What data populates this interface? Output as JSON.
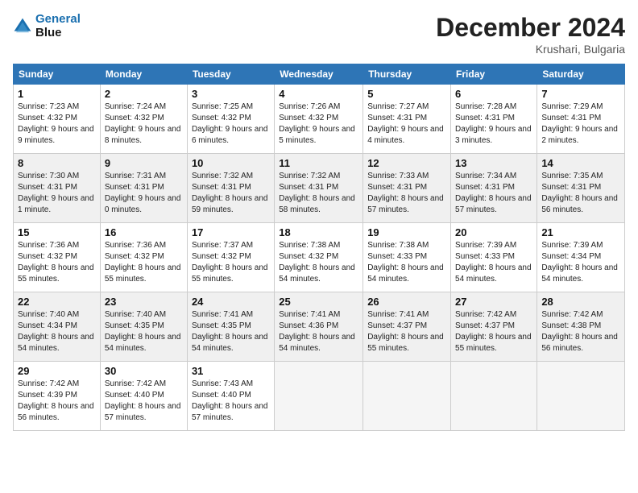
{
  "header": {
    "logo_line1": "General",
    "logo_line2": "Blue",
    "month_title": "December 2024",
    "location": "Krushari, Bulgaria"
  },
  "weekdays": [
    "Sunday",
    "Monday",
    "Tuesday",
    "Wednesday",
    "Thursday",
    "Friday",
    "Saturday"
  ],
  "weeks": [
    [
      {
        "day": "1",
        "sunrise": "7:23 AM",
        "sunset": "4:32 PM",
        "daylight": "9 hours and 9 minutes."
      },
      {
        "day": "2",
        "sunrise": "7:24 AM",
        "sunset": "4:32 PM",
        "daylight": "9 hours and 8 minutes."
      },
      {
        "day": "3",
        "sunrise": "7:25 AM",
        "sunset": "4:32 PM",
        "daylight": "9 hours and 6 minutes."
      },
      {
        "day": "4",
        "sunrise": "7:26 AM",
        "sunset": "4:32 PM",
        "daylight": "9 hours and 5 minutes."
      },
      {
        "day": "5",
        "sunrise": "7:27 AM",
        "sunset": "4:31 PM",
        "daylight": "9 hours and 4 minutes."
      },
      {
        "day": "6",
        "sunrise": "7:28 AM",
        "sunset": "4:31 PM",
        "daylight": "9 hours and 3 minutes."
      },
      {
        "day": "7",
        "sunrise": "7:29 AM",
        "sunset": "4:31 PM",
        "daylight": "9 hours and 2 minutes."
      }
    ],
    [
      {
        "day": "8",
        "sunrise": "7:30 AM",
        "sunset": "4:31 PM",
        "daylight": "9 hours and 1 minute."
      },
      {
        "day": "9",
        "sunrise": "7:31 AM",
        "sunset": "4:31 PM",
        "daylight": "9 hours and 0 minutes."
      },
      {
        "day": "10",
        "sunrise": "7:32 AM",
        "sunset": "4:31 PM",
        "daylight": "8 hours and 59 minutes."
      },
      {
        "day": "11",
        "sunrise": "7:32 AM",
        "sunset": "4:31 PM",
        "daylight": "8 hours and 58 minutes."
      },
      {
        "day": "12",
        "sunrise": "7:33 AM",
        "sunset": "4:31 PM",
        "daylight": "8 hours and 57 minutes."
      },
      {
        "day": "13",
        "sunrise": "7:34 AM",
        "sunset": "4:31 PM",
        "daylight": "8 hours and 57 minutes."
      },
      {
        "day": "14",
        "sunrise": "7:35 AM",
        "sunset": "4:31 PM",
        "daylight": "8 hours and 56 minutes."
      }
    ],
    [
      {
        "day": "15",
        "sunrise": "7:36 AM",
        "sunset": "4:32 PM",
        "daylight": "8 hours and 55 minutes."
      },
      {
        "day": "16",
        "sunrise": "7:36 AM",
        "sunset": "4:32 PM",
        "daylight": "8 hours and 55 minutes."
      },
      {
        "day": "17",
        "sunrise": "7:37 AM",
        "sunset": "4:32 PM",
        "daylight": "8 hours and 55 minutes."
      },
      {
        "day": "18",
        "sunrise": "7:38 AM",
        "sunset": "4:32 PM",
        "daylight": "8 hours and 54 minutes."
      },
      {
        "day": "19",
        "sunrise": "7:38 AM",
        "sunset": "4:33 PM",
        "daylight": "8 hours and 54 minutes."
      },
      {
        "day": "20",
        "sunrise": "7:39 AM",
        "sunset": "4:33 PM",
        "daylight": "8 hours and 54 minutes."
      },
      {
        "day": "21",
        "sunrise": "7:39 AM",
        "sunset": "4:34 PM",
        "daylight": "8 hours and 54 minutes."
      }
    ],
    [
      {
        "day": "22",
        "sunrise": "7:40 AM",
        "sunset": "4:34 PM",
        "daylight": "8 hours and 54 minutes."
      },
      {
        "day": "23",
        "sunrise": "7:40 AM",
        "sunset": "4:35 PM",
        "daylight": "8 hours and 54 minutes."
      },
      {
        "day": "24",
        "sunrise": "7:41 AM",
        "sunset": "4:35 PM",
        "daylight": "8 hours and 54 minutes."
      },
      {
        "day": "25",
        "sunrise": "7:41 AM",
        "sunset": "4:36 PM",
        "daylight": "8 hours and 54 minutes."
      },
      {
        "day": "26",
        "sunrise": "7:41 AM",
        "sunset": "4:37 PM",
        "daylight": "8 hours and 55 minutes."
      },
      {
        "day": "27",
        "sunrise": "7:42 AM",
        "sunset": "4:37 PM",
        "daylight": "8 hours and 55 minutes."
      },
      {
        "day": "28",
        "sunrise": "7:42 AM",
        "sunset": "4:38 PM",
        "daylight": "8 hours and 56 minutes."
      }
    ],
    [
      {
        "day": "29",
        "sunrise": "7:42 AM",
        "sunset": "4:39 PM",
        "daylight": "8 hours and 56 minutes."
      },
      {
        "day": "30",
        "sunrise": "7:42 AM",
        "sunset": "4:40 PM",
        "daylight": "8 hours and 57 minutes."
      },
      {
        "day": "31",
        "sunrise": "7:43 AM",
        "sunset": "4:40 PM",
        "daylight": "8 hours and 57 minutes."
      },
      null,
      null,
      null,
      null
    ]
  ],
  "labels": {
    "sunrise": "Sunrise:",
    "sunset": "Sunset:",
    "daylight": "Daylight:"
  }
}
